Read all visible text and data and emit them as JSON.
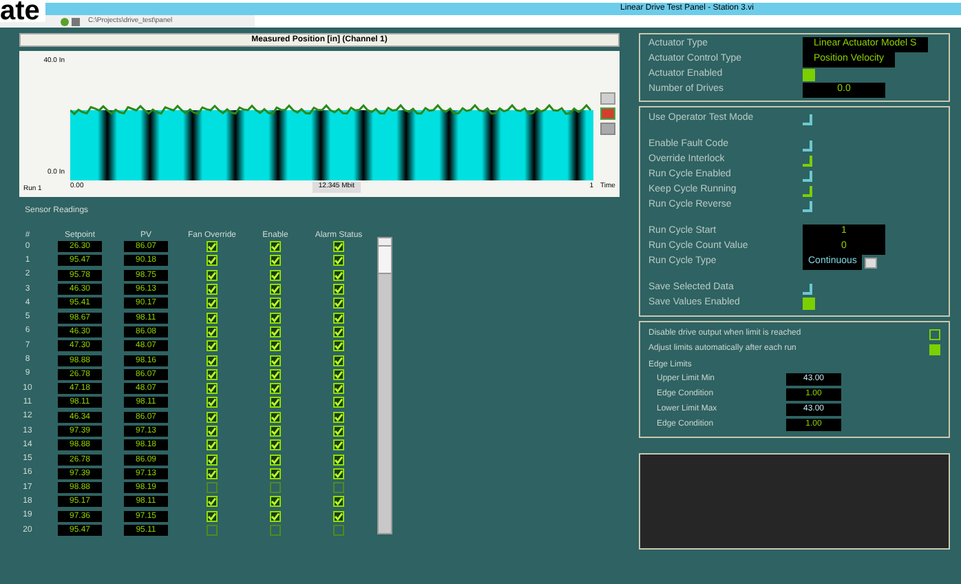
{
  "overlay_text": "ate",
  "window": {
    "title": "Linear Drive Test Panel - Station 3.vi"
  },
  "toolbar": {
    "path": "C:\\Projects\\drive_test\\panel"
  },
  "chart": {
    "title": "Measured Position [in] (Channel 1)",
    "y_top": "40.0 In",
    "y_bottom": "0.0 In",
    "run_label": "Run 1",
    "x_start": "0.00",
    "x_center": "12.345 Mbit",
    "x_end": "1",
    "x_unit": "Time"
  },
  "sensor_table": {
    "title": "Sensor Readings",
    "columns": [
      "#",
      "Setpoint",
      "PV",
      "Fan Override",
      "Enable",
      "Alarm Status"
    ],
    "rows": [
      {
        "index": "0",
        "setpoint": "26.30",
        "pv": "86.07",
        "fan_override": true,
        "enable": true,
        "alarm": true
      },
      {
        "index": "1",
        "setpoint": "95.47",
        "pv": "90.18",
        "fan_override": true,
        "enable": true,
        "alarm": true
      },
      {
        "index": "2",
        "setpoint": "95.78",
        "pv": "98.75",
        "fan_override": true,
        "enable": true,
        "alarm": true
      },
      {
        "index": "3",
        "setpoint": "46.30",
        "pv": "96.13",
        "fan_override": true,
        "enable": true,
        "alarm": true
      },
      {
        "index": "4",
        "setpoint": "95.41",
        "pv": "90.17",
        "fan_override": true,
        "enable": true,
        "alarm": true
      },
      {
        "index": "5",
        "setpoint": "98.67",
        "pv": "98.11",
        "fan_override": true,
        "enable": true,
        "alarm": true
      },
      {
        "index": "6",
        "setpoint": "46.30",
        "pv": "86.08",
        "fan_override": true,
        "enable": true,
        "alarm": true
      },
      {
        "index": "7",
        "setpoint": "47.30",
        "pv": "48.07",
        "fan_override": true,
        "enable": true,
        "alarm": true
      },
      {
        "index": "8",
        "setpoint": "98.88",
        "pv": "98.16",
        "fan_override": true,
        "enable": true,
        "alarm": true
      },
      {
        "index": "9",
        "setpoint": "26.78",
        "pv": "86.07",
        "fan_override": true,
        "enable": true,
        "alarm": true
      },
      {
        "index": "10",
        "setpoint": "47.18",
        "pv": "48.07",
        "fan_override": true,
        "enable": true,
        "alarm": true
      },
      {
        "index": "11",
        "setpoint": "98.11",
        "pv": "98.11",
        "fan_override": true,
        "enable": true,
        "alarm": true
      },
      {
        "index": "12",
        "setpoint": "46.34",
        "pv": "86.07",
        "fan_override": true,
        "enable": true,
        "alarm": true
      },
      {
        "index": "13",
        "setpoint": "97.39",
        "pv": "97.13",
        "fan_override": true,
        "enable": true,
        "alarm": true
      },
      {
        "index": "14",
        "setpoint": "98.88",
        "pv": "98.18",
        "fan_override": true,
        "enable": true,
        "alarm": true
      },
      {
        "index": "15",
        "setpoint": "26.78",
        "pv": "86.09",
        "fan_override": true,
        "enable": true,
        "alarm": true
      },
      {
        "index": "16",
        "setpoint": "97.39",
        "pv": "97.13",
        "fan_override": true,
        "enable": true,
        "alarm": true
      },
      {
        "index": "17",
        "setpoint": "98.88",
        "pv": "98.19",
        "fan_override": false,
        "enable": false,
        "alarm": false
      },
      {
        "index": "18",
        "setpoint": "95.17",
        "pv": "98.11",
        "fan_override": true,
        "enable": true,
        "alarm": true
      },
      {
        "index": "19",
        "setpoint": "97.36",
        "pv": "97.15",
        "fan_override": true,
        "enable": true,
        "alarm": true
      },
      {
        "index": "20",
        "setpoint": "95.47",
        "pv": "95.11",
        "fan_override": false,
        "enable": false,
        "alarm": false
      }
    ]
  },
  "actuator": [
    {
      "kind": "display",
      "label": "Actuator Type",
      "value": "Linear Actuator Model S"
    },
    {
      "kind": "display",
      "label": "Actuator Control Type",
      "value": "Position Velocity"
    },
    {
      "kind": "led",
      "label": "Actuator Enabled",
      "on": true
    },
    {
      "kind": "display",
      "label": "Number of Drives",
      "value": "0.0"
    }
  ],
  "test_settings": [
    {
      "kind": "toggle",
      "label": "Use Operator Test Mode",
      "on": false
    },
    {
      "kind": "gap"
    },
    {
      "kind": "toggle",
      "label": "Enable Fault Code",
      "on": false
    },
    {
      "kind": "toggle",
      "label": "Override Interlock",
      "on": true
    },
    {
      "kind": "toggle",
      "label": "Run Cycle Enabled",
      "on": false
    },
    {
      "kind": "toggle",
      "label": "Keep Cycle Running",
      "on": true
    },
    {
      "kind": "toggle",
      "label": "Run Cycle Reverse",
      "on": false
    },
    {
      "kind": "gap"
    },
    {
      "kind": "display",
      "label": "Run Cycle Start",
      "value": "1"
    },
    {
      "kind": "display",
      "label": "Run Cycle Count Value",
      "value": "0"
    },
    {
      "kind": "dropdown",
      "label": "Run Cycle Type",
      "value": "Continuous"
    },
    {
      "kind": "gap"
    },
    {
      "kind": "toggle",
      "label": "Save Selected Data",
      "on": false
    },
    {
      "kind": "led",
      "label": "Save Values Enabled",
      "on": true
    }
  ],
  "options": [
    {
      "label": "Disable drive output when limit is reached",
      "checked": false
    },
    {
      "label": "Adjust limits automatically after each run",
      "checked": true
    }
  ],
  "edge_limits": {
    "title": "Edge Limits",
    "fields": [
      {
        "label": "Upper Limit Min",
        "value": "43.00",
        "kind": "limit"
      },
      {
        "label": "Edge Condition",
        "value": "1.00",
        "kind": "condition"
      },
      {
        "label": "Lower Limit Max",
        "value": "43.00",
        "kind": "limit"
      },
      {
        "label": "Edge Condition",
        "value": "1.00",
        "kind": "condition"
      }
    ]
  }
}
